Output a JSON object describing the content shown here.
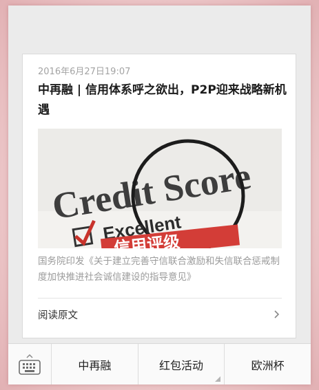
{
  "article": {
    "date": "2016年6月27日19:07",
    "title": "中再融 | 信用体系呼之欲出，P2P迎来战略新机遇",
    "cover": {
      "text_credit": "Credit Score",
      "text_excellent": "Excellent",
      "text_stamp": "信用评级"
    },
    "digest": "国务院印发《关于建立完善守信联合激励和失信联合惩戒制度加快推进社会诚信建设的指导意见》",
    "read_more": "阅读原文"
  },
  "menu": {
    "keyboard_icon": "keyboard-icon",
    "items": [
      {
        "label": "中再融",
        "has_submenu": false
      },
      {
        "label": "红包活动",
        "has_submenu": true
      },
      {
        "label": "欧洲杯",
        "has_submenu": false
      }
    ]
  }
}
